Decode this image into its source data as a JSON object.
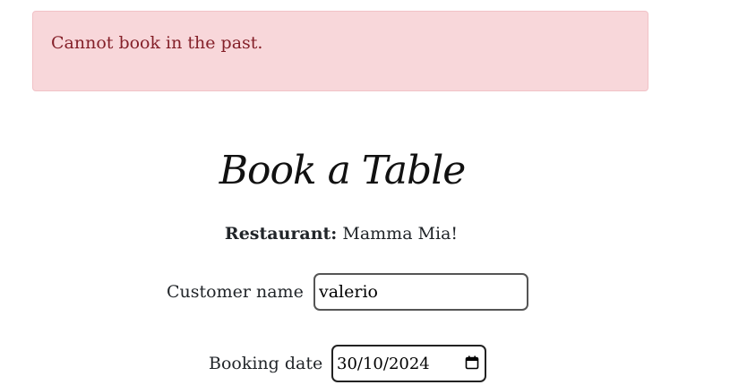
{
  "alert": {
    "message": "Cannot book in the past."
  },
  "form": {
    "title": "Book a Table",
    "restaurant_label": "Restaurant:",
    "restaurant_value": "Mamma Mia!",
    "customer_name_label": "Customer name",
    "customer_name_value": "valerio",
    "booking_date_label": "Booking date",
    "booking_date_value": "30/10/2024"
  },
  "colors": {
    "alert_bg": "#f8d7da",
    "alert_text": "#842029"
  }
}
